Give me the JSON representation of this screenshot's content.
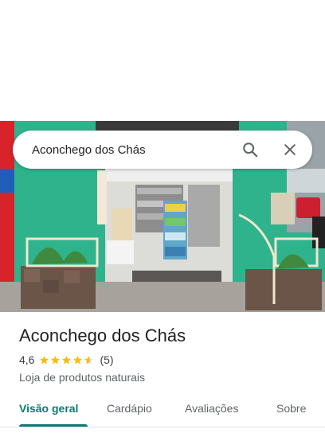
{
  "search": {
    "query": "Aconchego dos Chás"
  },
  "place": {
    "name": "Aconchego dos Chás",
    "rating": "4,6",
    "rating_stars": 4.6,
    "review_count": "(5)",
    "category": "Loja de produtos naturais"
  },
  "tabs": [
    {
      "label": "Visão geral",
      "active": true
    },
    {
      "label": "Cardápio",
      "active": false
    },
    {
      "label": "Avaliações",
      "active": false
    },
    {
      "label": "Sobre",
      "active": false
    }
  ],
  "colors": {
    "accent": "#0b7a75",
    "star": "#fbbc04",
    "storefront": "#2bb08a"
  },
  "icons": {
    "search": "search-icon",
    "close": "close-icon",
    "star": "star-icon"
  }
}
